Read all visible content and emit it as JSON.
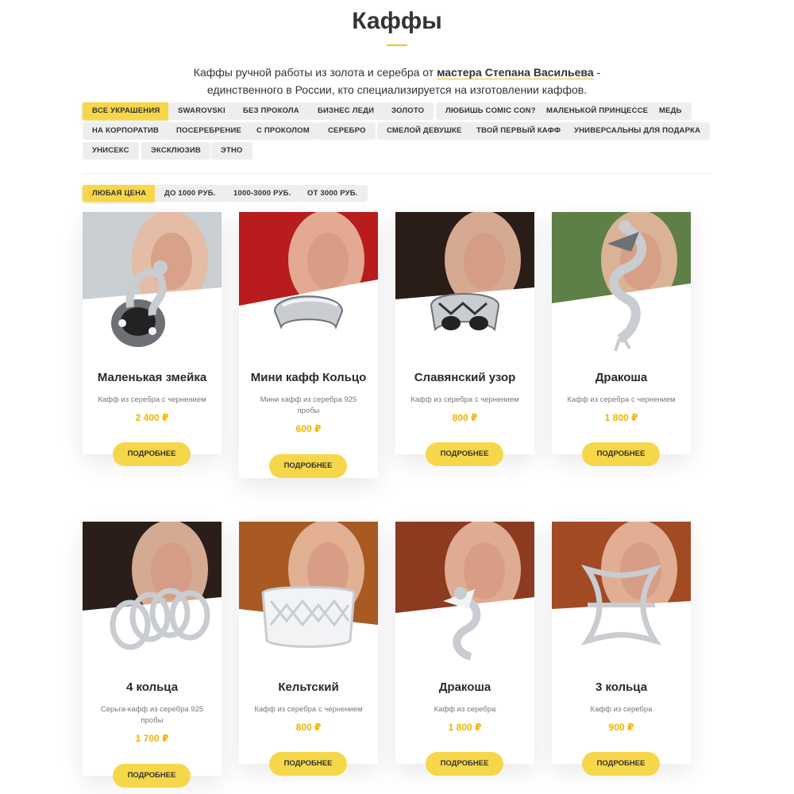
{
  "page": {
    "title": "Каффы"
  },
  "intro": {
    "text_before": "Каффы ручной работы из золота и серебра от ",
    "master": "мастера Степана Васильева",
    "text_after": " - единственного в России, кто специализируется на изготовлении каффов."
  },
  "filters": {
    "categories": [
      {
        "label": "ВСЕ УКРАШЕНИЯ",
        "active": true
      },
      {
        "label": "SWAROVSKI"
      },
      {
        "label": "БЕЗ ПРОКОЛА"
      },
      {
        "label": "БИЗНЕС ЛЕДИ"
      },
      {
        "label": "ЗОЛОТО"
      },
      {
        "label": "ЛЮБИШЬ COMIC CON?"
      },
      {
        "label": "МАЛЕНЬКОЙ ПРИНЦЕССЕ"
      },
      {
        "label": "МЕДЬ"
      },
      {
        "label": "НА КОРПОРАТИВ"
      },
      {
        "label": "ПОСЕРЕБРЕНИЕ"
      },
      {
        "label": "С ПРОКОЛОМ"
      },
      {
        "label": "СЕРЕБРО"
      },
      {
        "label": "СМЕЛОЙ ДЕВУШКЕ"
      },
      {
        "label": "ТВОЙ ПЕРВЫЙ КАФФ"
      },
      {
        "label": "УНИВЕРСАЛЬНЫ ДЛЯ ПОДАРКА"
      },
      {
        "label": "УНИСЕКС"
      },
      {
        "label": "ЭКСКЛЮЗИВ"
      },
      {
        "label": "ЭТНО"
      }
    ],
    "prices": [
      {
        "label": "ЛЮБАЯ ЦЕНА",
        "active": true
      },
      {
        "label": "ДО 1000 РУБ."
      },
      {
        "label": "1000-3000 РУБ."
      },
      {
        "label": "ОТ 3000 РУБ."
      }
    ]
  },
  "products": [
    {
      "name": "Маленькая змейка",
      "desc": "Кафф из серебра с чернением",
      "price": "2 400 ₽",
      "button": "ПОДРОБНЕЕ",
      "image": "snake-ear-cuff-photo",
      "bg": "#c9cfd2"
    },
    {
      "name": "Мини кафф Кольцо",
      "desc": "Мини кафф из серебра 925 пробы",
      "price": "600 ₽",
      "button": "ПОДРОБНЕЕ",
      "image": "ring-ear-cuff-photo",
      "bg": "#b81c1c"
    },
    {
      "name": "Славянский узор",
      "desc": "Кафф из серебра с чернением",
      "price": "800 ₽",
      "button": "ПОДРОБНЕЕ",
      "image": "slavic-pattern-cuff-photo",
      "bg": "#2a1c17"
    },
    {
      "name": "Дракоша",
      "desc": "Кафф из серебра с чернением",
      "price": "1 800 ₽",
      "button": "ПОДРОБНЕЕ",
      "image": "dragon-cuff-photo",
      "bg": "#5e7f45"
    },
    {
      "name": "4 кольца",
      "desc": "Серьга-кафф из серебра 925 пробы",
      "price": "1 700 ₽",
      "button": "ПОДРОБНЕЕ",
      "image": "four-rings-cuff-photo",
      "bg": "#2b1e1a"
    },
    {
      "name": "Кельтский",
      "desc": "Кафф из серебра с чернением",
      "price": "800 ₽",
      "button": "ПОДРОБНЕЕ",
      "image": "celtic-cuff-photo",
      "bg": "#a85a22"
    },
    {
      "name": "Дракоша",
      "desc": "Кафф из серебра",
      "price": "1 800 ₽",
      "button": "ПОДРОБНЕЕ",
      "image": "dragon-cuff-model-photo",
      "bg": "#8c3a20"
    },
    {
      "name": "3 кольца",
      "desc": "Кафф из серебра",
      "price": "900 ₽",
      "button": "ПОДРОБНЕЕ",
      "image": "three-rings-cuff-photo",
      "bg": "#a14a24"
    }
  ]
}
